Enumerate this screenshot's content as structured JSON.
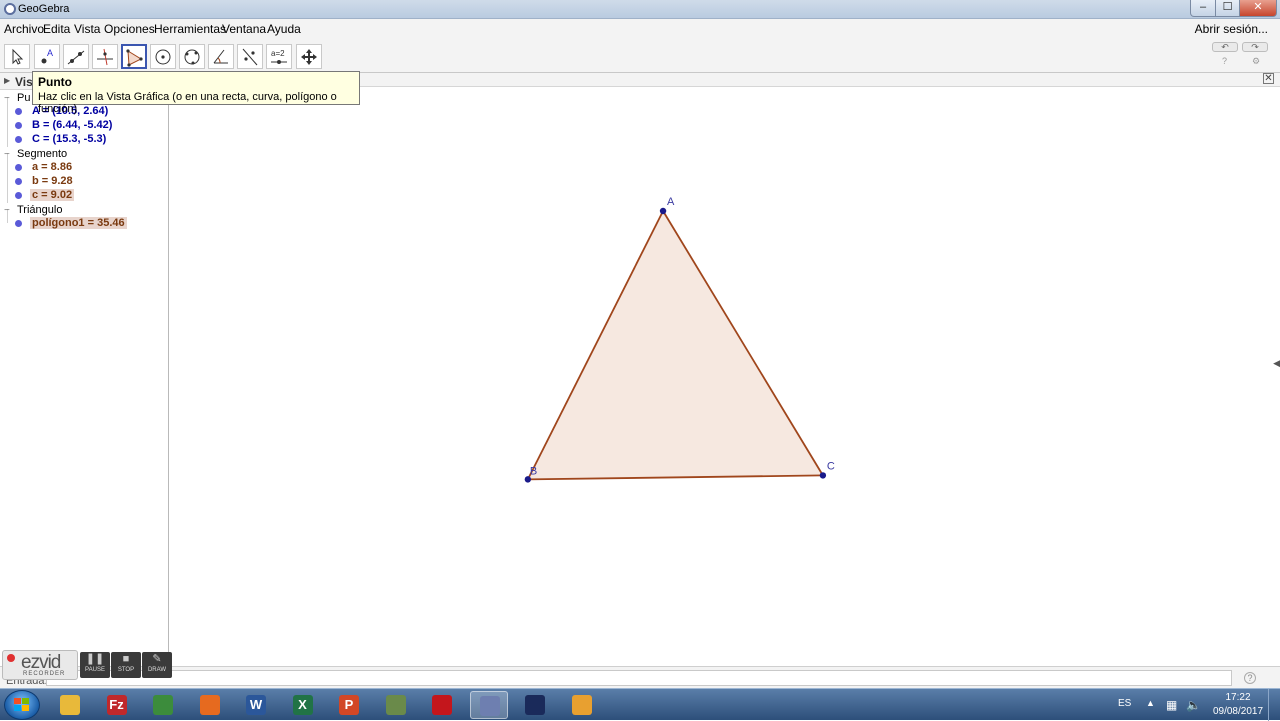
{
  "window": {
    "title": "GeoGebra",
    "min": "–",
    "max": "☐",
    "close": "✕"
  },
  "menu": {
    "items": [
      "Archivo",
      "Edita",
      "Vista",
      "Opciones",
      "Herramientas",
      "Ventana",
      "Ayuda"
    ],
    "login": "Abrir sesión..."
  },
  "toolbar": {
    "tools": [
      {
        "name": "move",
        "icon": "move-arrow-icon"
      },
      {
        "name": "point",
        "icon": "point-icon"
      },
      {
        "name": "line",
        "icon": "line-icon"
      },
      {
        "name": "perpendicular",
        "icon": "perpendicular-line-icon"
      },
      {
        "name": "polygon",
        "icon": "polygon-icon",
        "active": true
      },
      {
        "name": "circle",
        "icon": "circle-icon"
      },
      {
        "name": "conic",
        "icon": "conic-icon"
      },
      {
        "name": "angle",
        "icon": "angle-icon"
      },
      {
        "name": "reflect",
        "icon": "reflect-icon"
      },
      {
        "name": "slider",
        "icon": "slider-icon",
        "text": "a=2"
      },
      {
        "name": "move-view",
        "icon": "move-graphics-view-icon"
      }
    ],
    "undo": "↶",
    "redo": "↷"
  },
  "tooltip": {
    "title": "Punto",
    "text": "Haz clic en la Vista Gráfica (o en una recta, curva, polígono o función)"
  },
  "algebra": {
    "header": "Vis",
    "categories": [
      {
        "name": "Pu",
        "items": [
          {
            "text": "A = (10.5, 2.64)",
            "kind": "point"
          },
          {
            "text": "B = (6.44, -5.42)",
            "kind": "point"
          },
          {
            "text": "C = (15.3, -5.3)",
            "kind": "point"
          }
        ]
      },
      {
        "name": "Segmento",
        "items": [
          {
            "text": "a = 8.86",
            "kind": "segment"
          },
          {
            "text": "b = 9.28",
            "kind": "segment"
          },
          {
            "text": "c = 9.02",
            "kind": "segment",
            "selected": true
          }
        ]
      },
      {
        "name": "Triángulo",
        "items": [
          {
            "text": "polígono1 = 35.46",
            "kind": "segment",
            "selected": true
          }
        ]
      }
    ]
  },
  "graphics": {
    "triangle": {
      "fill": "#f6e8e0",
      "stroke": "#a0461c",
      "points": [
        {
          "label": "A",
          "x": 10.5,
          "y": 2.64
        },
        {
          "label": "B",
          "x": 6.44,
          "y": -5.42
        },
        {
          "label": "C",
          "x": 15.3,
          "y": -5.3
        }
      ]
    },
    "point_color": "#1a1a8a",
    "close": "✕"
  },
  "inputbar": {
    "label": "Entrada:",
    "help": "?"
  },
  "ezvid": {
    "logo": "ezvid",
    "sub": "RECORDER",
    "pause": "PAUSE",
    "stop": "STOP",
    "draw": "DRAW"
  },
  "taskbar": {
    "apps": [
      {
        "name": "explorer",
        "icon": "folder-icon",
        "color": "#e8b93a"
      },
      {
        "name": "filezilla",
        "icon": "filezilla-icon",
        "color": "#c0282b",
        "text": "Fz"
      },
      {
        "name": "chrome",
        "icon": "chrome-icon",
        "color": "#3c8c3c"
      },
      {
        "name": "firefox",
        "icon": "firefox-icon",
        "color": "#e66a1f"
      },
      {
        "name": "word",
        "icon": "word-icon",
        "color": "#2b579a",
        "text": "W"
      },
      {
        "name": "excel",
        "icon": "excel-icon",
        "color": "#217346",
        "text": "X"
      },
      {
        "name": "powerpoint",
        "icon": "powerpoint-icon",
        "color": "#d24726",
        "text": "P"
      },
      {
        "name": "game",
        "icon": "gamepad-icon",
        "color": "#6a8a4a"
      },
      {
        "name": "acrobat",
        "icon": "pdf-icon",
        "color": "#c4161c"
      },
      {
        "name": "geogebra",
        "icon": "geogebra-icon",
        "color": "#6e7fb0",
        "active": true
      },
      {
        "name": "sketch",
        "icon": "sketch-icon",
        "color": "#1a2a5a"
      },
      {
        "name": "scratch",
        "icon": "scratch-cat-icon",
        "color": "#e8a030"
      }
    ],
    "tray": {
      "lang": "ES",
      "time": "17:22",
      "date": "09/08/2017"
    }
  }
}
